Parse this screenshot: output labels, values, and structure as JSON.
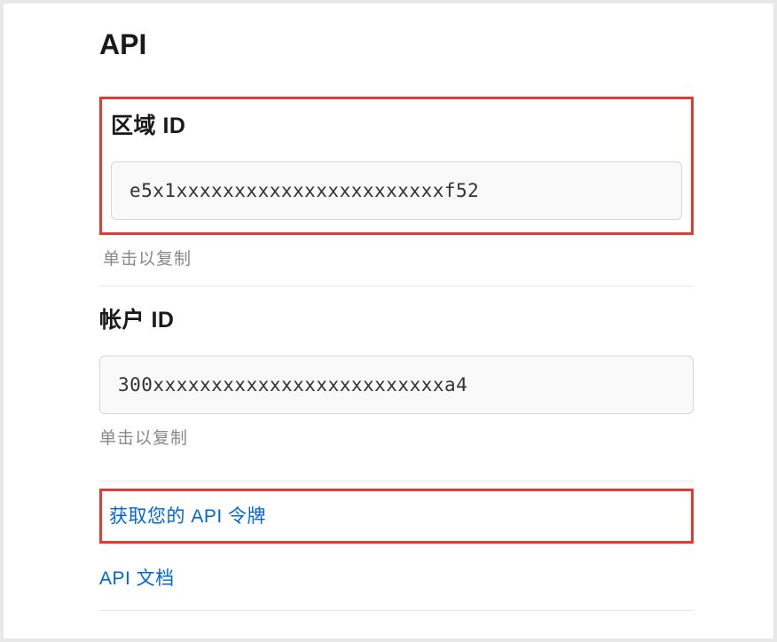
{
  "page": {
    "title": "API"
  },
  "zone": {
    "label": "区域 ID",
    "value": "e5x1xxxxxxxxxxxxxxxxxxxxxxxf52",
    "helpText": "单击以复制"
  },
  "account": {
    "label": "帐户 ID",
    "value": "300xxxxxxxxxxxxxxxxxxxxxxxxxa4",
    "helpText": "单击以复制"
  },
  "links": {
    "getToken": "获取您的 API 令牌",
    "apiDocs": "API 文档"
  },
  "highlight": {
    "zoneBox": true,
    "tokenLink": true,
    "color": "#e73833"
  }
}
